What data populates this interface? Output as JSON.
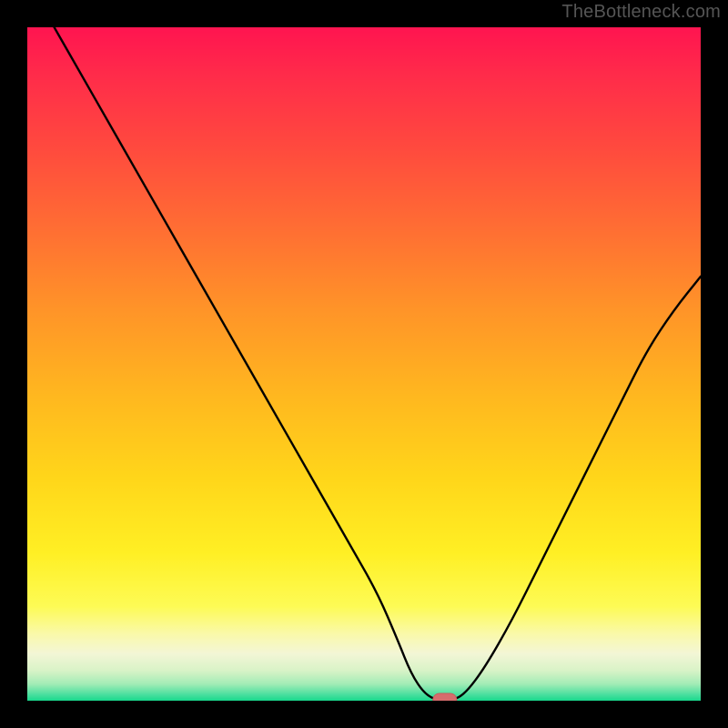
{
  "watermark": "TheBottleneck.com",
  "colors": {
    "frame": "#000000",
    "gradient_stops": [
      {
        "offset": 0.0,
        "color": "#ff1450"
      },
      {
        "offset": 0.07,
        "color": "#ff2b4a"
      },
      {
        "offset": 0.18,
        "color": "#ff4a3e"
      },
      {
        "offset": 0.3,
        "color": "#ff6e33"
      },
      {
        "offset": 0.42,
        "color": "#ff9428"
      },
      {
        "offset": 0.55,
        "color": "#ffb81f"
      },
      {
        "offset": 0.67,
        "color": "#ffd61a"
      },
      {
        "offset": 0.78,
        "color": "#ffef24"
      },
      {
        "offset": 0.86,
        "color": "#fdfb55"
      },
      {
        "offset": 0.9,
        "color": "#faf9a8"
      },
      {
        "offset": 0.93,
        "color": "#f3f6d6"
      },
      {
        "offset": 0.955,
        "color": "#d9f3c7"
      },
      {
        "offset": 0.975,
        "color": "#a3ecb6"
      },
      {
        "offset": 0.99,
        "color": "#4fe0a0"
      },
      {
        "offset": 1.0,
        "color": "#18d98c"
      }
    ],
    "curve": "#000000",
    "marker_fill": "#d66d6d",
    "marker_stroke": "#c85c5c"
  },
  "chart_data": {
    "type": "line",
    "title": "",
    "xlabel": "",
    "ylabel": "",
    "xlim": [
      0,
      100
    ],
    "ylim": [
      0,
      100
    ],
    "grid": false,
    "x": [
      4,
      8,
      12,
      16,
      20,
      24,
      28,
      32,
      36,
      40,
      44,
      48,
      52,
      55,
      57,
      59,
      61,
      63,
      65,
      68,
      72,
      76,
      80,
      84,
      88,
      92,
      96,
      100
    ],
    "values": [
      100,
      93,
      86,
      79,
      72,
      65,
      58,
      51,
      44,
      37,
      30,
      23,
      16,
      9,
      4,
      1,
      0,
      0,
      1,
      5,
      12,
      20,
      28,
      36,
      44,
      52,
      58,
      63
    ],
    "marker": {
      "x": 62,
      "y": 0
    },
    "annotations": []
  }
}
